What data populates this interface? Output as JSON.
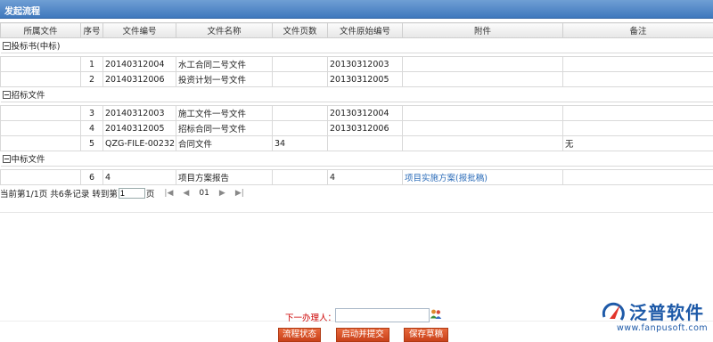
{
  "window": {
    "title": "发起流程"
  },
  "table": {
    "columns": [
      "所属文件",
      "序号",
      "文件编号",
      "文件名称",
      "文件页数",
      "文件原始编号",
      "附件",
      "备注"
    ],
    "groups": [
      {
        "name": "投标书(中标)",
        "rows": [
          {
            "seq": "1",
            "file_no": "20140312004",
            "file_name": "水工合同二号文件",
            "pages": "",
            "orig_no": "20130312003",
            "attachment": "",
            "remark": ""
          },
          {
            "seq": "2",
            "file_no": "20140312006",
            "file_name": "投资计划一号文件",
            "pages": "",
            "orig_no": "20130312005",
            "attachment": "",
            "remark": ""
          }
        ]
      },
      {
        "name": "招标文件",
        "rows": [
          {
            "seq": "3",
            "file_no": "20140312003",
            "file_name": "施工文件一号文件",
            "pages": "",
            "orig_no": "20130312004",
            "attachment": "",
            "remark": ""
          },
          {
            "seq": "4",
            "file_no": "20140312005",
            "file_name": "招标合同一号文件",
            "pages": "",
            "orig_no": "20130312006",
            "attachment": "",
            "remark": ""
          },
          {
            "seq": "5",
            "file_no": "QZG-FILE-00232",
            "file_name": "合同文件",
            "pages": "34",
            "orig_no": "",
            "attachment": "",
            "remark": "无"
          }
        ]
      },
      {
        "name": "中标文件",
        "rows": [
          {
            "seq": "6",
            "file_no": "4",
            "file_name": "项目方案报告",
            "pages": "",
            "orig_no": "4",
            "attachment": "项目实施方案(报批稿)",
            "remark": ""
          }
        ]
      }
    ]
  },
  "pager": {
    "summary": "当前第1/1页 共6条记录 转到第",
    "page_input": "1",
    "page_suffix": "页",
    "current_page": "01"
  },
  "footer": {
    "next_handler_label": "下一办理人：",
    "buttons": {
      "status": "流程状态",
      "start_submit": "启动并提交",
      "save_draft": "保存草稿"
    }
  },
  "logo": {
    "brand": "泛普软件",
    "url": "www.fanpusoft.com"
  },
  "colors": {
    "titlebar": "#3f78bd",
    "button": "#d4512a",
    "brand": "#1e5aa8",
    "link": "#2a6bb8",
    "label_red": "#cc0000"
  }
}
